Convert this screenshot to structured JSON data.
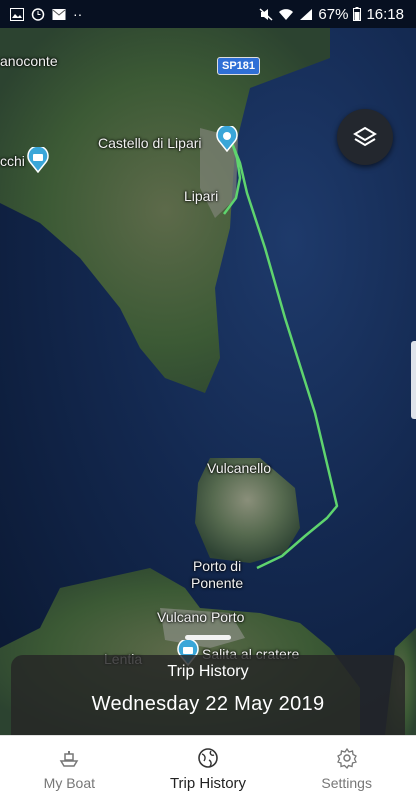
{
  "status_bar": {
    "battery": "67%",
    "time": "16:18",
    "dots": "··"
  },
  "map": {
    "labels": {
      "anoconte": "anoconte",
      "castello": "Castello di Lipari",
      "lipari": "Lipari",
      "cchi": "cchi",
      "vulcanello": "Vulcanello",
      "porto_di_ponente": "Porto di\nPonente",
      "vulcano_porto": "Vulcano Porto",
      "lentia": "Lentia",
      "salita": "Salita al cratere"
    },
    "road_badge": "SP181",
    "colors": {
      "track": "#5fd46e",
      "land": "#3c5a35",
      "sea": "#13284f"
    }
  },
  "trip_panel": {
    "title": "Trip History",
    "date": "Wednesday 22 May 2019"
  },
  "nav": {
    "items": [
      {
        "label": "My Boat",
        "icon": "boat-icon"
      },
      {
        "label": "Trip History",
        "icon": "globe-icon"
      },
      {
        "label": "Settings",
        "icon": "gear-icon"
      }
    ]
  }
}
